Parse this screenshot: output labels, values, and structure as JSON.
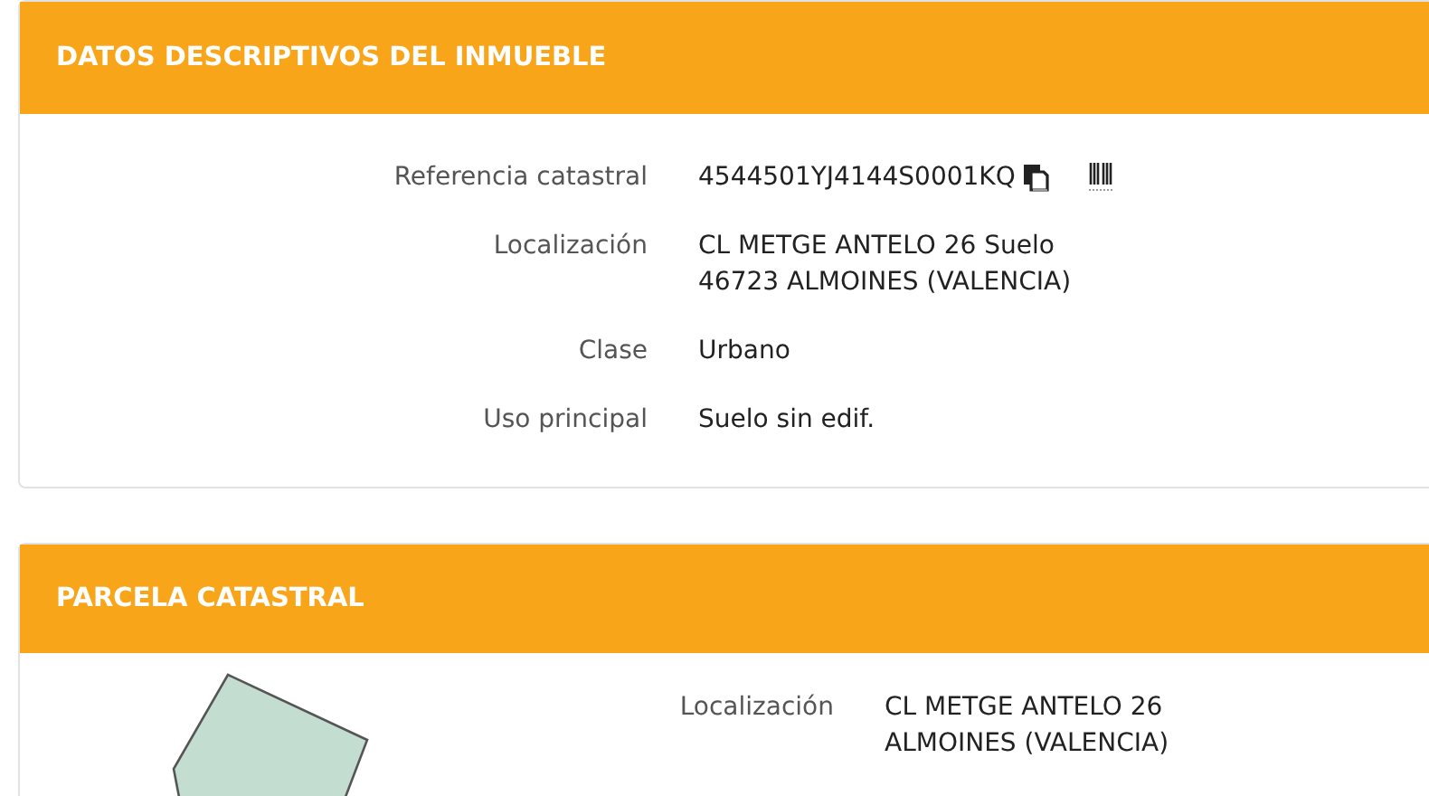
{
  "sections": [
    {
      "title": "DATOS DESCRIPTIVOS DEL INMUEBLE",
      "fields": [
        {
          "label": "Referencia catastral",
          "value": [
            "4544501YJ4144S0001KQ"
          ],
          "kind": "reference"
        },
        {
          "label": "Localización",
          "value": [
            "CL METGE ANTELO 26 Suelo",
            "46723 ALMOINES (VALENCIA)"
          ],
          "kind": "text"
        },
        {
          "label": "Clase",
          "value": [
            "Urbano"
          ],
          "kind": "text"
        },
        {
          "label": "Uso principal",
          "value": [
            "Suelo sin edif."
          ],
          "kind": "text"
        }
      ]
    },
    {
      "title": "PARCELA CATASTRAL",
      "kind": "parcel",
      "fields": [
        {
          "label": "Localización",
          "value": [
            "CL METGE ANTELO 26",
            "ALMOINES (VALENCIA)"
          ],
          "kind": "text"
        }
      ]
    }
  ]
}
